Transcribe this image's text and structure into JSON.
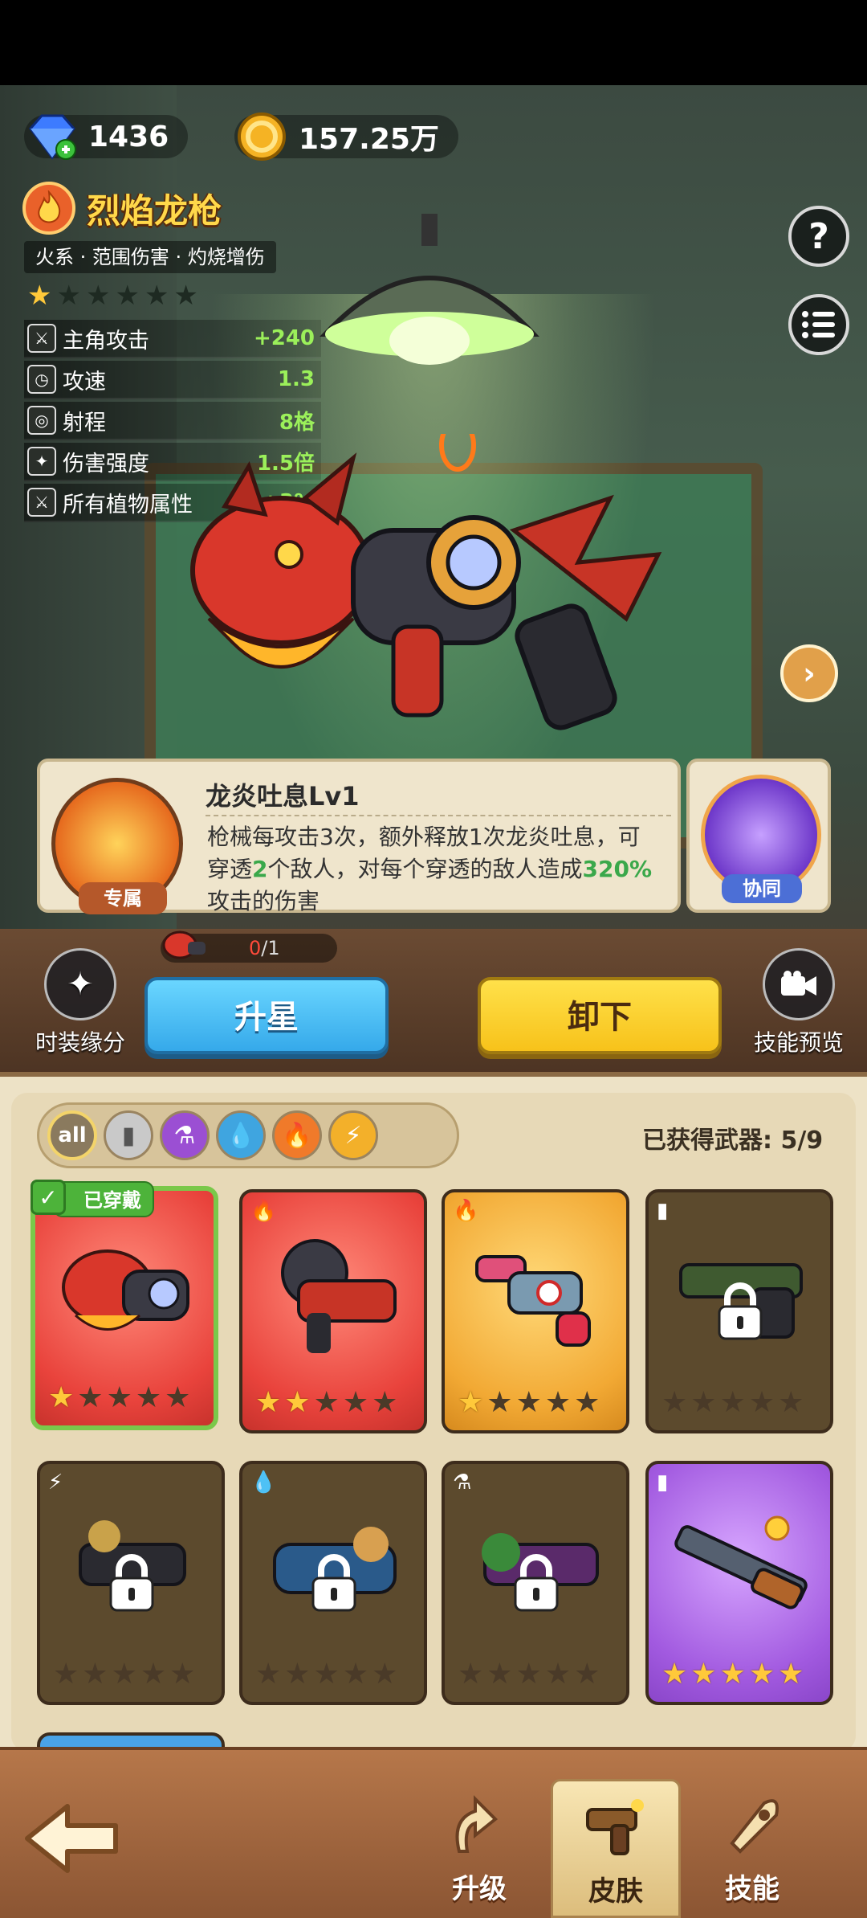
{
  "currency": {
    "gems": "1436",
    "gold": "157.25万"
  },
  "weapon": {
    "name": "烈焰龙枪",
    "tags": "火系 · 范围伤害 · 灼烧增伤",
    "stars": 1,
    "max_stars": 6
  },
  "stats": [
    {
      "label": "主角攻击",
      "value": "+240",
      "icon": "attack-icon"
    },
    {
      "label": "攻速",
      "value": "1.3",
      "icon": "clock-icon"
    },
    {
      "label": "射程",
      "value": "8格",
      "icon": "target-icon"
    },
    {
      "label": "伤害强度",
      "value": "1.5倍",
      "icon": "damage-icon"
    },
    {
      "label": "所有植物属性",
      "value": "+3%",
      "icon": "plant-attack-icon"
    }
  ],
  "skill": {
    "name": "龙炎吐息Lv1",
    "badge": "专属",
    "desc_1": "枪械每攻击3次，额外释放1次龙炎吐息，可穿透",
    "desc_hl_1": "2",
    "desc_2": "个敌人，对每个穿透的敌人造成",
    "desc_hl_2": "320%",
    "desc_3": "攻击的伤害"
  },
  "coop": {
    "badge": "协同"
  },
  "shard_progress": {
    "current": "0",
    "total": "/1"
  },
  "buttons": {
    "fashion": "时装缘分",
    "star_up": "升星",
    "unequip": "卸下",
    "skill_preview": "技能预览"
  },
  "filters": [
    "all"
  ],
  "obtained_label": "已获得武器: 5/9",
  "equipped_label": "已穿戴",
  "cards": [
    {
      "color": "red",
      "element": "fire",
      "stars": 1,
      "locked": false,
      "equipped": true
    },
    {
      "color": "red",
      "element": "fire",
      "stars": 2,
      "locked": false,
      "equipped": false
    },
    {
      "color": "gold",
      "element": "fire",
      "stars": 1,
      "locked": false,
      "equipped": false
    },
    {
      "color": "brown",
      "element": "metal",
      "stars": 0,
      "locked": true,
      "equipped": false
    },
    {
      "color": "brown",
      "element": "thunder",
      "stars": 0,
      "locked": true,
      "equipped": false
    },
    {
      "color": "brown",
      "element": "water",
      "stars": 0,
      "locked": true,
      "equipped": false
    },
    {
      "color": "brown",
      "element": "poison",
      "stars": 0,
      "locked": true,
      "equipped": false
    },
    {
      "color": "purple",
      "element": "metal",
      "stars": 5,
      "locked": false,
      "equipped": false
    },
    {
      "color": "blue",
      "element": "metal",
      "stars": 0,
      "locked": false,
      "equipped": false
    }
  ],
  "nav": {
    "upgrade": "升级",
    "skin": "皮肤",
    "skill": "技能",
    "active": "skin"
  },
  "colors": {
    "accent_green": "#9bf05a",
    "star": "#ffc93a",
    "title": "#ffd84a"
  }
}
